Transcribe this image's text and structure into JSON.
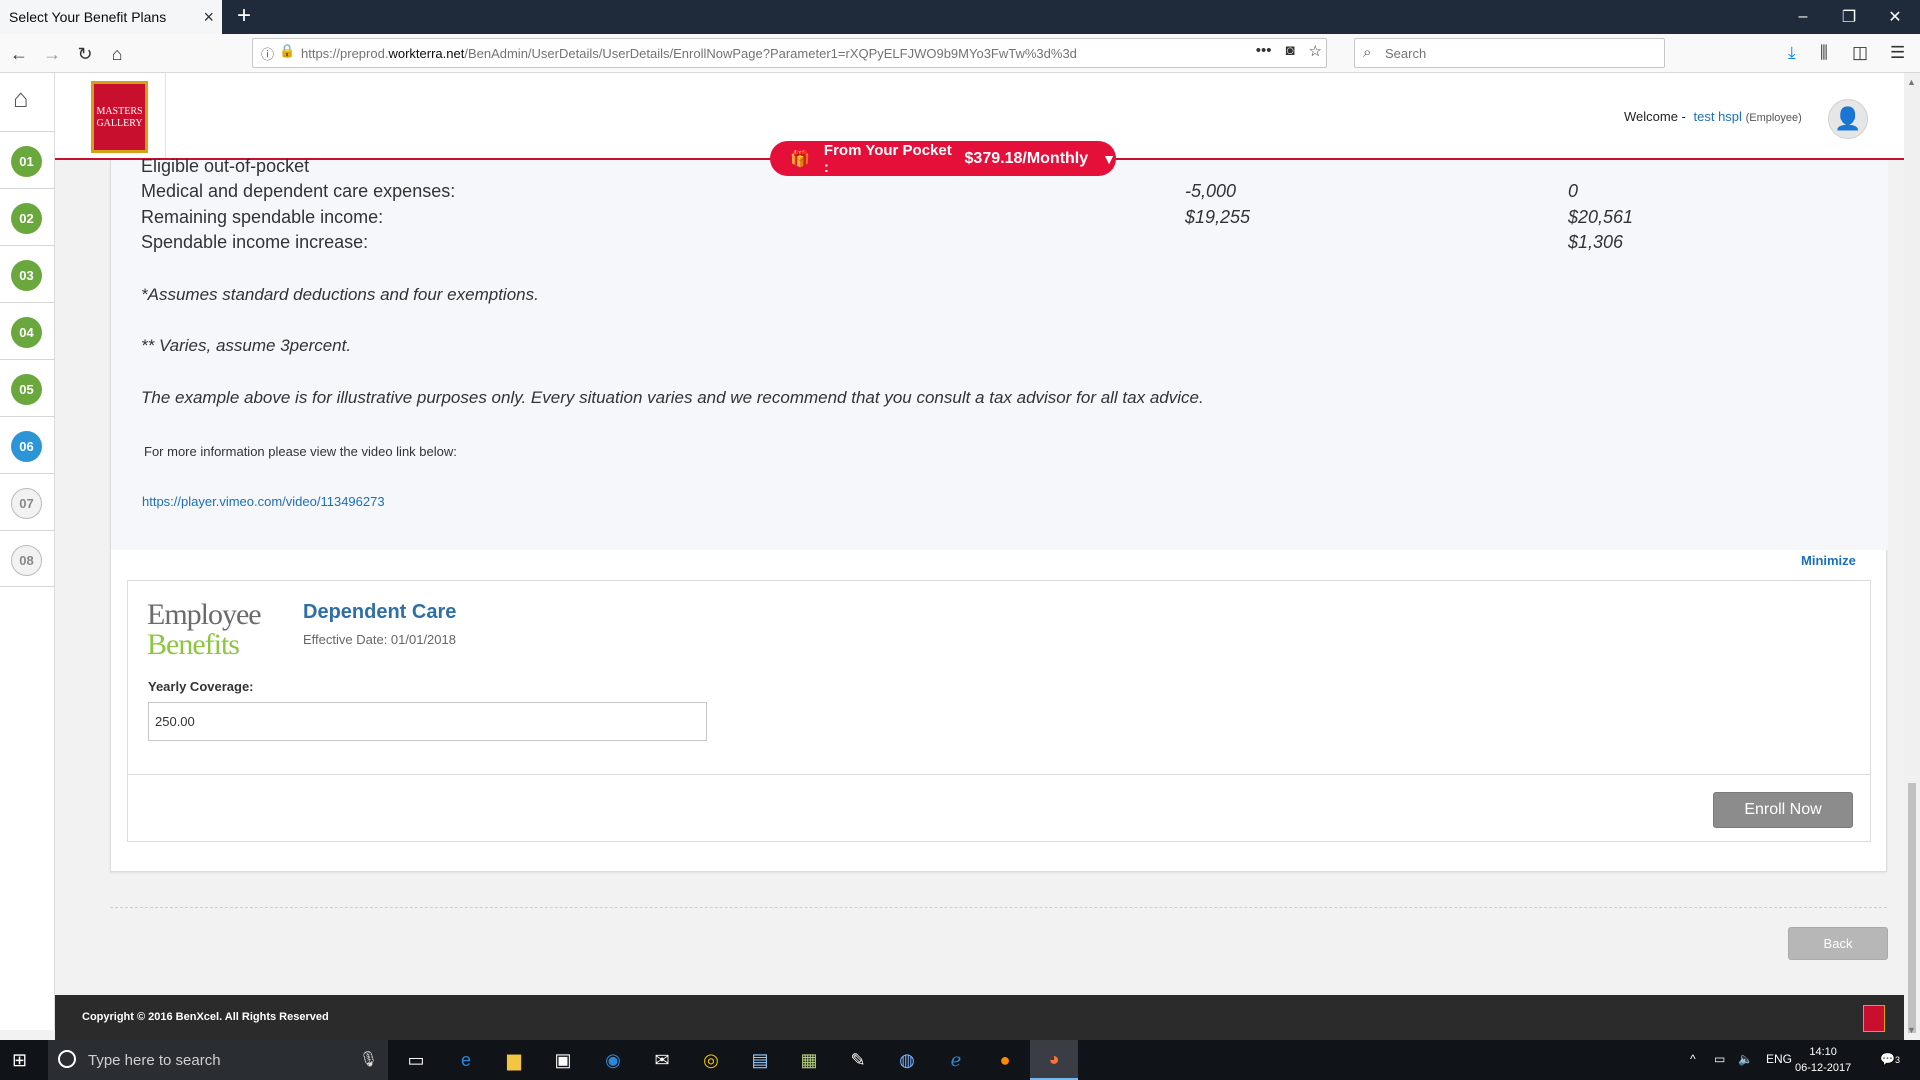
{
  "browser": {
    "tab_title": "Select Your Benefit Plans",
    "url_prefix": "https://preprod.",
    "url_host": "workterra.net",
    "url_path": "/BenAdmin/UserDetails/UserDetails/EnrollNowPage?Parameter1=rXQPyELFJWO9b9MYo3FwTw%3d%3d",
    "search_placeholder": "Search"
  },
  "header": {
    "logo_text": "MASTERS GALLERY",
    "welcome_label": "Welcome -",
    "user_name": "test hspl",
    "user_role": "(Employee)"
  },
  "pocket": {
    "label": "From Your Pocket :",
    "amount": "$379.18/Monthly"
  },
  "steps": [
    {
      "label": "01",
      "state": "done"
    },
    {
      "label": "02",
      "state": "done"
    },
    {
      "label": "03",
      "state": "done"
    },
    {
      "label": "04",
      "state": "done"
    },
    {
      "label": "05",
      "state": "done"
    },
    {
      "label": "06",
      "state": "active"
    },
    {
      "label": "07",
      "state": "future"
    },
    {
      "label": "08",
      "state": "future"
    }
  ],
  "info": {
    "rows": [
      {
        "label": "Eligible out-of-pocket",
        "col1": "",
        "col2": ""
      },
      {
        "label": "Medical and dependent care expenses:",
        "col1": "-5,000",
        "col2": "0"
      },
      {
        "label": "Remaining spendable income:",
        "col1": "$19,255",
        "col2": "$20,561"
      },
      {
        "label": "Spendable income increase:",
        "col1": "",
        "col2": "$1,306"
      }
    ],
    "note1": "*Assumes standard deductions and four exemptions.",
    "note2": "** Varies, assume 3percent.",
    "note3": "The example above is for illustrative purposes only. Every situation varies and we recommend that you consult a tax advisor for all tax advice.",
    "more_info": "For more information please view the video link below:",
    "video_link": "https://player.vimeo.com/video/113496273",
    "minimize": "Minimize"
  },
  "plan": {
    "logo_line1": "Employee",
    "logo_line2": "Benefits",
    "title": "Dependent Care",
    "effective": "Effective Date: 01/01/2018",
    "coverage_label": "Yearly Coverage:",
    "coverage_value": "250.00",
    "enroll_label": "Enroll Now"
  },
  "back_label": "Back",
  "footer": {
    "copyright": "Copyright © 2016 BenXcel. All Rights Reserved"
  },
  "taskbar": {
    "search_placeholder": "Type here to search",
    "lang": "ENG",
    "time": "14:10",
    "date": "06-12-2017",
    "notifications": "3"
  }
}
